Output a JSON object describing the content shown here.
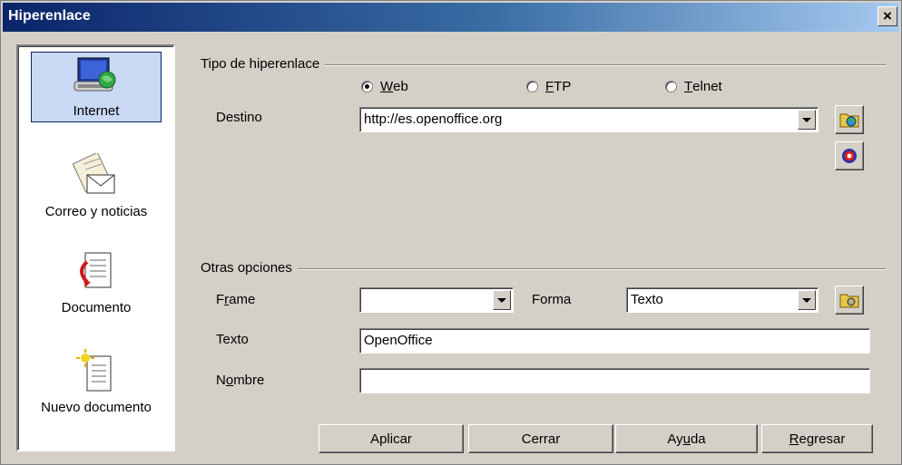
{
  "window": {
    "title": "Hiperenlace",
    "close_glyph": "×"
  },
  "sidebar": {
    "items": [
      {
        "label": "Internet",
        "icon": "internet-icon",
        "selected": true
      },
      {
        "label": "Correo y noticias",
        "icon": "mail-news-icon",
        "selected": false
      },
      {
        "label": "Documento",
        "icon": "document-icon",
        "selected": false
      },
      {
        "label": "Nuevo documento",
        "icon": "new-document-icon",
        "selected": false
      }
    ]
  },
  "link_type": {
    "group_label": "Tipo de hiperenlace",
    "options": [
      {
        "pre": "",
        "accel": "W",
        "post": "eb",
        "selected": true
      },
      {
        "pre": "",
        "accel": "F",
        "post": "TP",
        "selected": false
      },
      {
        "pre": "",
        "accel": "T",
        "post": "elnet",
        "selected": false
      }
    ],
    "target_label": "Destino",
    "target_value": "http://es.openoffice.org"
  },
  "other": {
    "group_label": "Otras opciones",
    "frame_label_pre": "F",
    "frame_label_accel": "r",
    "frame_label_post": "ame",
    "frame_value": "",
    "form_label": "Forma",
    "form_value": "Texto",
    "text_label": "Texto",
    "text_value": "OpenOffice",
    "name_label_pre": "N",
    "name_label_accel": "o",
    "name_label_post": "mbre",
    "name_value": ""
  },
  "buttons": {
    "apply": "Aplicar",
    "close": "Cerrar",
    "help_pre": "Ay",
    "help_accel": "u",
    "help_post": "da",
    "back_pre": "",
    "back_accel": "R",
    "back_post": "egresar"
  },
  "colors": {
    "titlebar_start": "#0a246a",
    "titlebar_end": "#a6caf0",
    "dialog_bg": "#d4d0c8",
    "selection": "#c9d8f3"
  }
}
